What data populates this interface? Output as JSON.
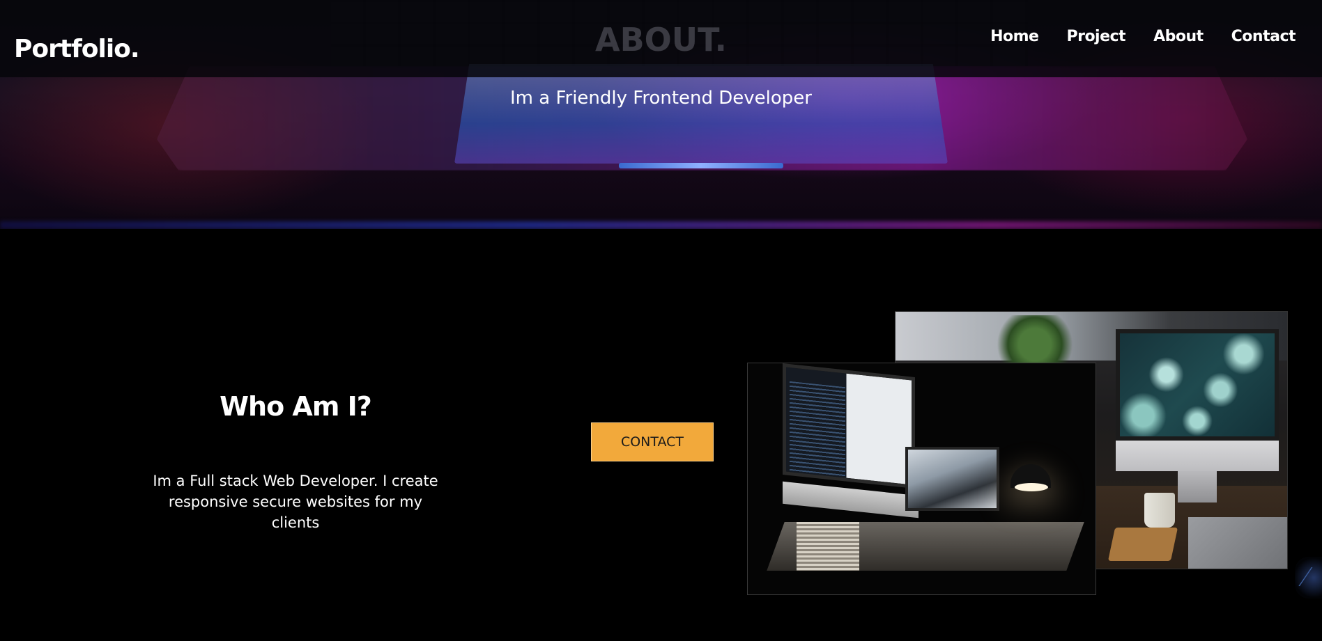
{
  "navbar": {
    "logo": "Portfolio.",
    "links": [
      "Home",
      "Project",
      "About",
      "Contact"
    ]
  },
  "hero": {
    "heading": "ABOUT.",
    "subtitle": "Im a Friendly Frontend Developer"
  },
  "about": {
    "title": "Who Am I?",
    "description": "Im a Full stack Web Developer. I create responsive secure websites for my clients",
    "button_label": "CONTACT"
  },
  "colors": {
    "accent": "#f2a93b",
    "background": "#000000",
    "text": "#ffffff"
  },
  "icons": {
    "corner_widget": "slash-logo-icon"
  }
}
